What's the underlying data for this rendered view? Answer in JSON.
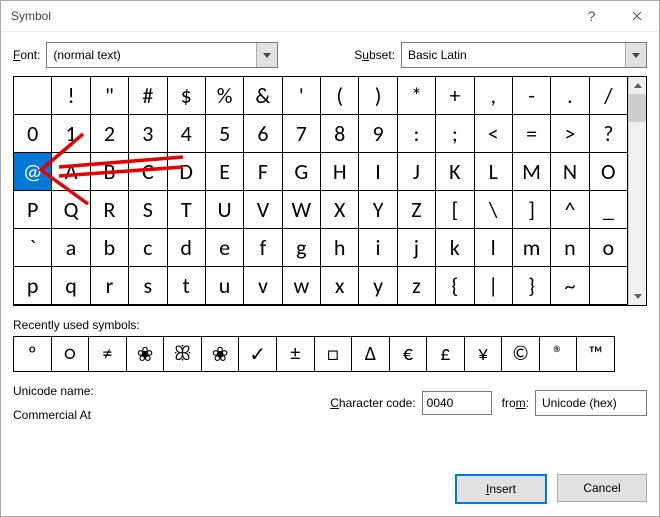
{
  "title": "Symbol",
  "labels": {
    "font": "Font:",
    "subset": "Subset:",
    "recent": "Recently used symbols:",
    "unicode_name": "Unicode name:",
    "char_code": "Character code:",
    "from": "from:"
  },
  "font_value": "(normal text)",
  "subset_value": "Basic Latin",
  "grid": [
    [
      " ",
      "!",
      "\"",
      "#",
      "$",
      "%",
      "&",
      "'",
      "(",
      ")",
      "*",
      "+",
      ",",
      "-",
      ".",
      "/"
    ],
    [
      "0",
      "1",
      "2",
      "3",
      "4",
      "5",
      "6",
      "7",
      "8",
      "9",
      ":",
      ";",
      "<",
      "=",
      ">",
      "?"
    ],
    [
      "@",
      "A",
      "B",
      "C",
      "D",
      "E",
      "F",
      "G",
      "H",
      "I",
      "J",
      "K",
      "L",
      "M",
      "N",
      "O"
    ],
    [
      "P",
      "Q",
      "R",
      "S",
      "T",
      "U",
      "V",
      "W",
      "X",
      "Y",
      "Z",
      "[",
      "\\",
      "]",
      "^",
      "_"
    ],
    [
      "`",
      "a",
      "b",
      "c",
      "d",
      "e",
      "f",
      "g",
      "h",
      "i",
      "j",
      "k",
      "l",
      "m",
      "n",
      "o"
    ],
    [
      "p",
      "q",
      "r",
      "s",
      "t",
      "u",
      "v",
      "w",
      "x",
      "y",
      "z",
      "{",
      "|",
      "}",
      "~",
      " "
    ]
  ],
  "selected": "@",
  "recent": [
    "º",
    "○",
    "≠",
    "❀",
    "ꕥ",
    "❀",
    "✓",
    "±",
    "□",
    "Δ",
    "€",
    "£",
    "¥",
    "©",
    "®",
    "™"
  ],
  "unicode_name_value": "Commercial At",
  "char_code_value": "0040",
  "from_value": "Unicode (hex)",
  "buttons": {
    "insert": "Insert",
    "cancel": "Cancel"
  }
}
